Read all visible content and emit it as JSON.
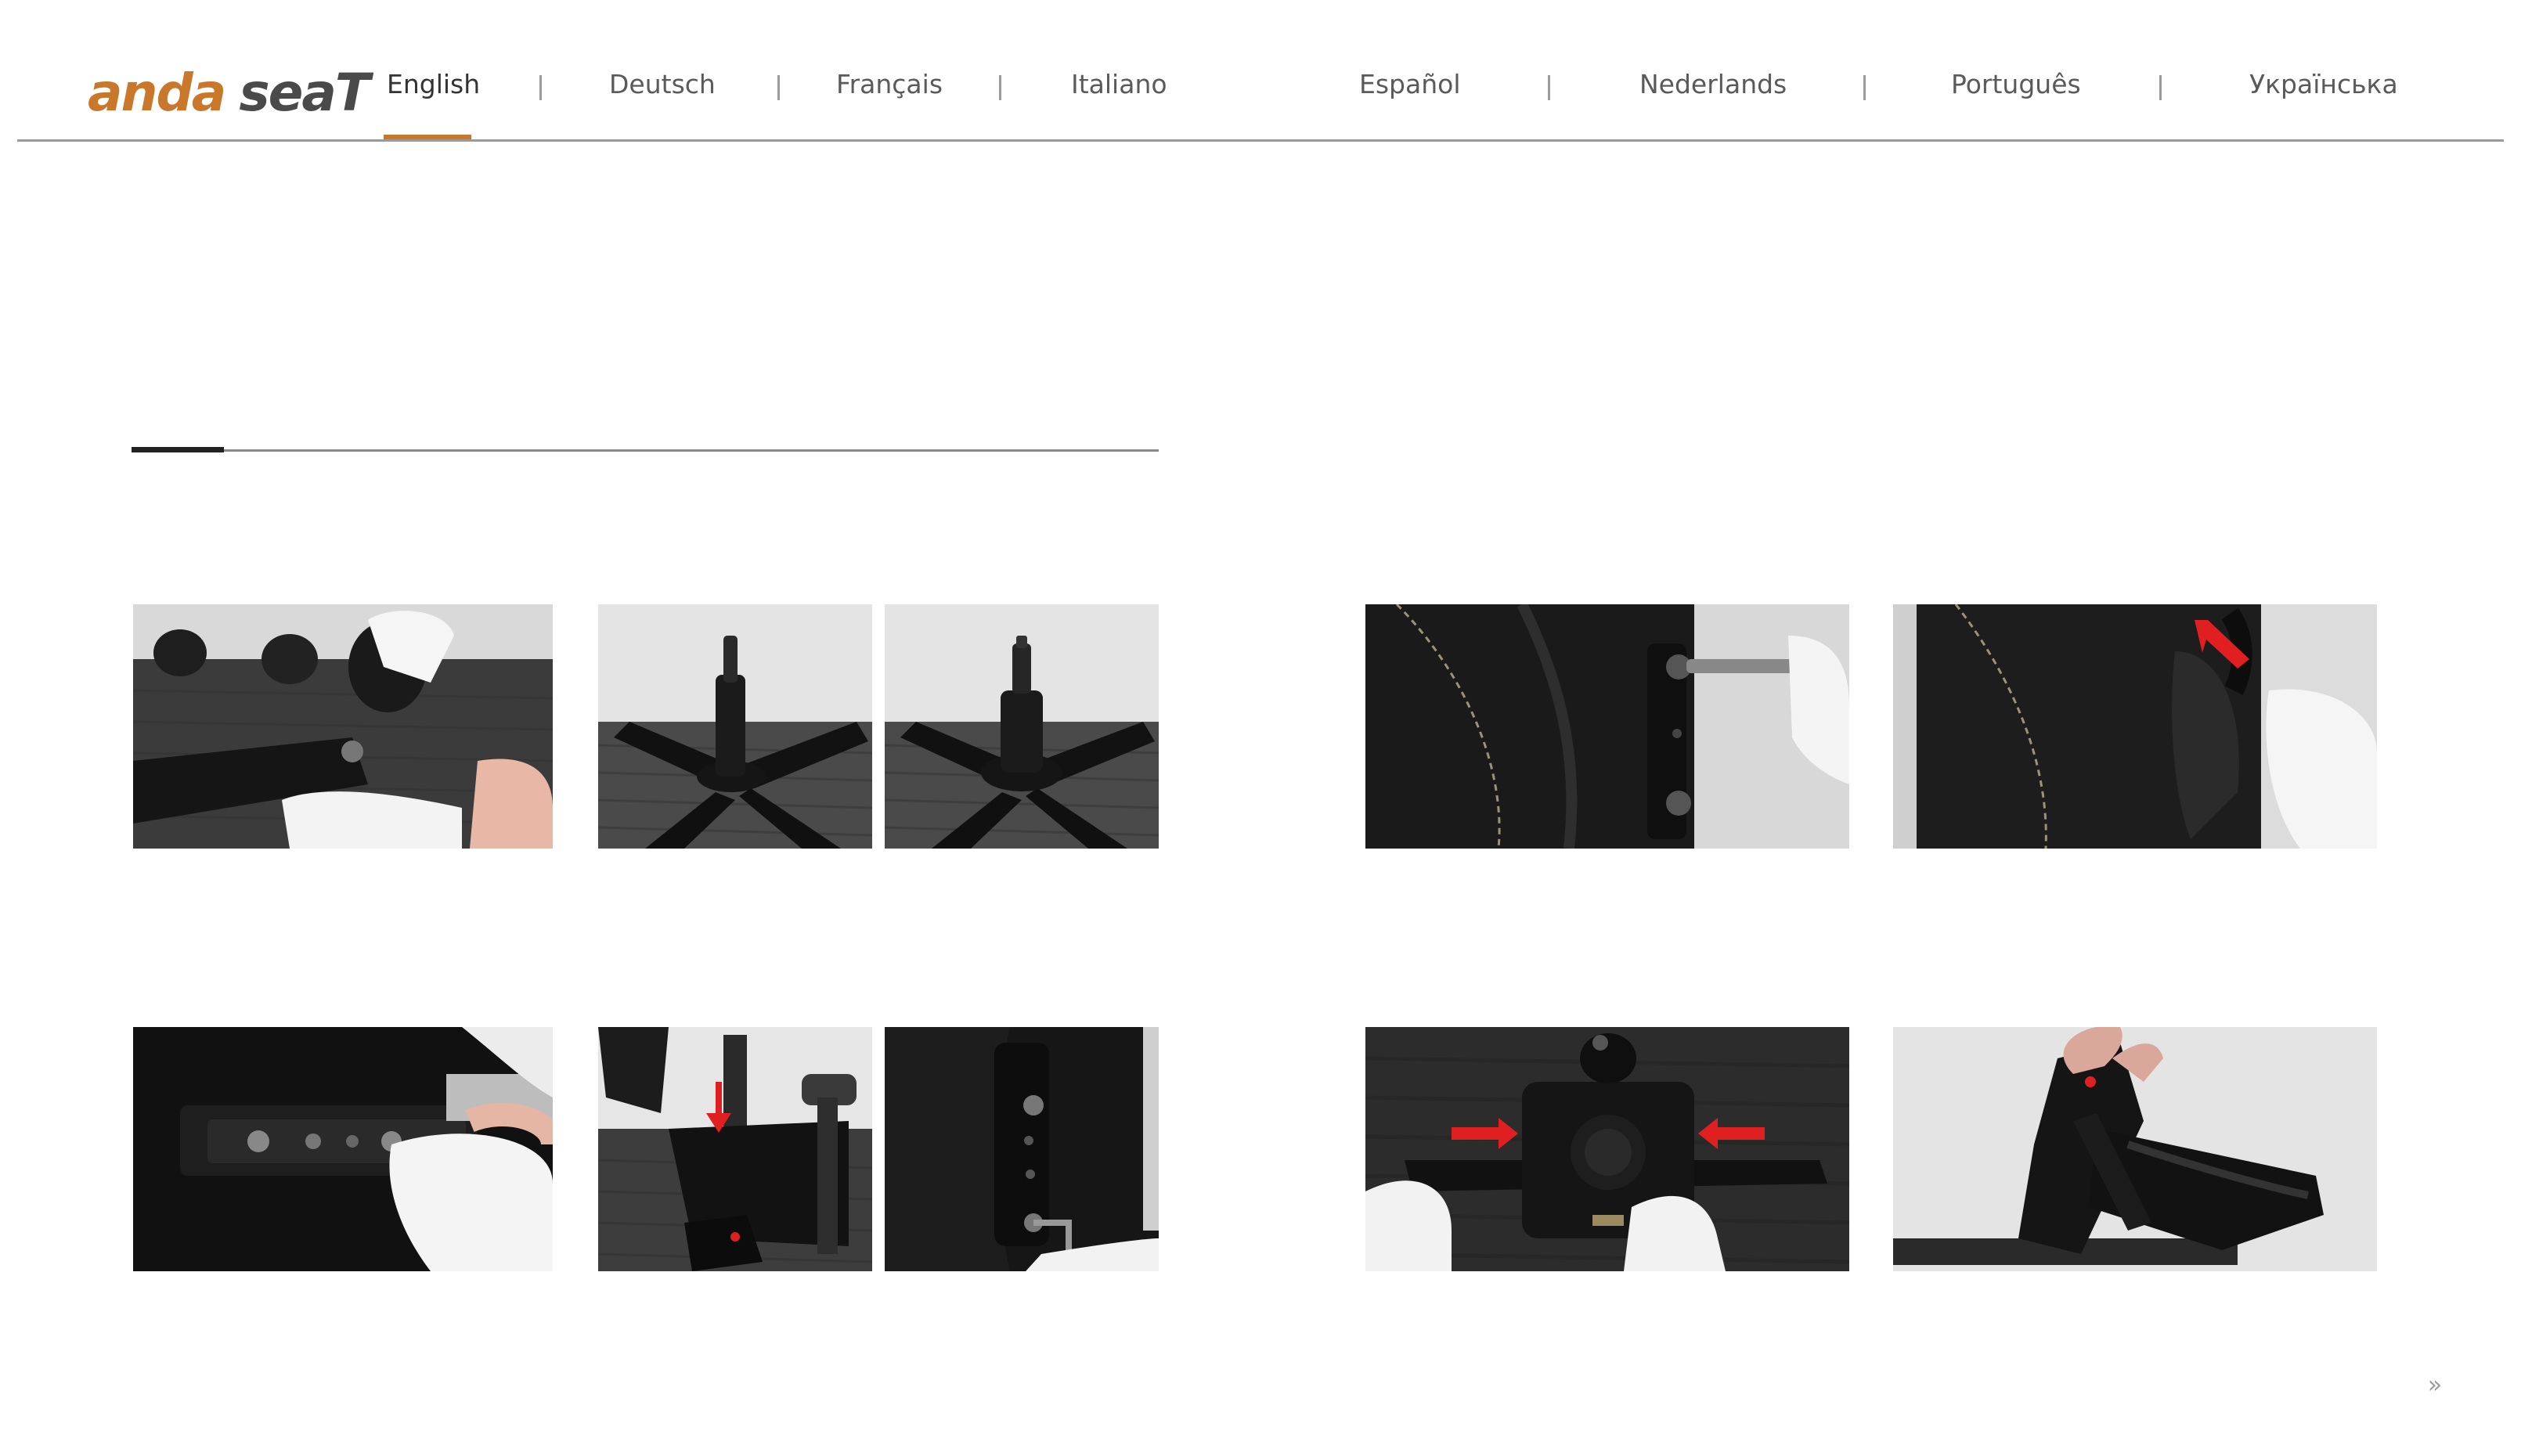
{
  "brand": {
    "logo_text_primary": "anda",
    "logo_text_secondary": "seaT",
    "accent_color": "#c9772a",
    "dark_color": "#4a4a4a"
  },
  "nav": {
    "languages": [
      {
        "label": "English",
        "active": true
      },
      {
        "label": "Deutsch",
        "active": false
      },
      {
        "label": "Français",
        "active": false
      },
      {
        "label": "Italiano",
        "active": false
      },
      {
        "label": "Español",
        "active": false
      },
      {
        "label": "Nederlands",
        "active": false
      },
      {
        "label": "Português",
        "active": false
      },
      {
        "label": "Українська",
        "active": false
      }
    ],
    "separator": "|"
  },
  "progress": {
    "value": 0.09
  },
  "gallery": {
    "photos": [
      {
        "name": "photo-caster-insert",
        "icon": "caster-icon"
      },
      {
        "name": "photo-base-step-a",
        "icon": "chair-base-icon"
      },
      {
        "name": "photo-base-step-b",
        "icon": "chair-base-icon"
      },
      {
        "name": "photo-backrest-screw",
        "icon": "screwdriver-icon"
      },
      {
        "name": "photo-backrest-cover",
        "icon": "cover-icon"
      },
      {
        "name": "photo-seat-plate",
        "icon": "bolt-icon"
      },
      {
        "name": "photo-armrest-mount-a",
        "icon": "arrow-down-icon"
      },
      {
        "name": "photo-armrest-mount-b",
        "icon": "hex-key-icon"
      },
      {
        "name": "photo-mechanism",
        "icon": "arrows-inward-icon"
      },
      {
        "name": "photo-back-attach",
        "icon": "chair-icon"
      }
    ]
  },
  "pager": {
    "next_icon": "double-chevron-right-icon",
    "next_label": "»"
  }
}
